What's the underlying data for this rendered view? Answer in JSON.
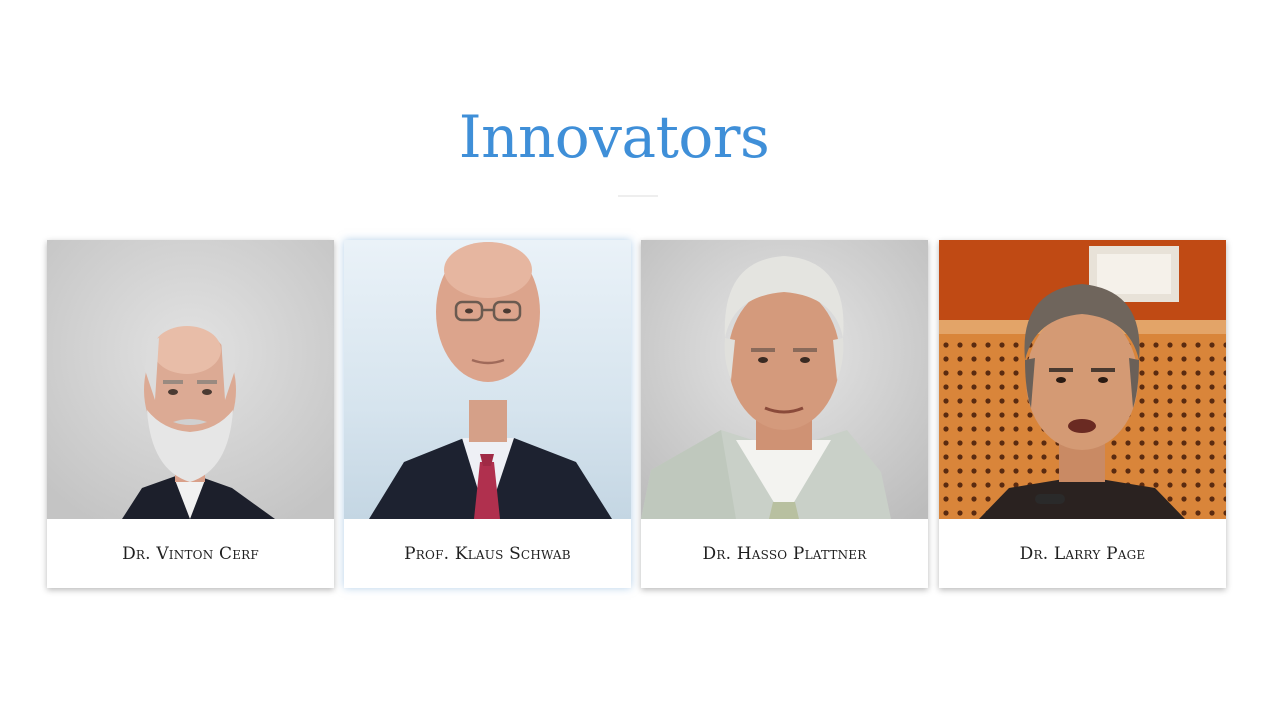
{
  "slide": {
    "title": "Innovators"
  },
  "innovators": [
    {
      "name": "Dr. Vinton Cerf",
      "photo_icon": "portrait-vinton-cerf"
    },
    {
      "name": "Prof. Klaus Schwab",
      "photo_icon": "portrait-klaus-schwab"
    },
    {
      "name": "Dr. Hasso Plattner",
      "photo_icon": "portrait-hasso-plattner"
    },
    {
      "name": "Dr. Larry Page",
      "photo_icon": "portrait-larry-page"
    }
  ],
  "colors": {
    "title": "#3f8fd8",
    "caption_text": "#1f1f1f",
    "background": "#ffffff"
  }
}
